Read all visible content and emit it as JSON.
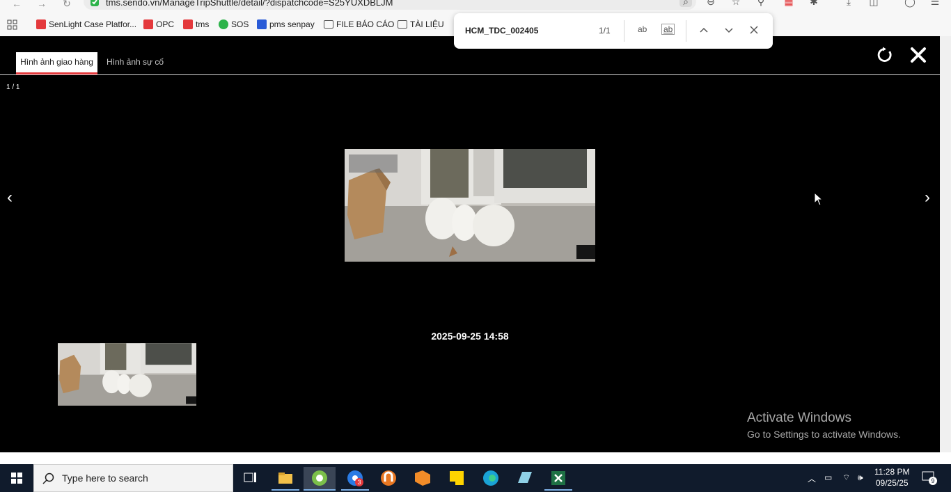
{
  "browser": {
    "url": "tms.sendo.vn/ManageTripShuttle/detail/?dispatchcode=S25YUXDBLJM",
    "bookmarks": [
      {
        "label": "SenLight Case Platfor...",
        "icon": "sendo-icon",
        "color": "#e4393c"
      },
      {
        "label": "OPC",
        "icon": "sendo-icon",
        "color": "#e4393c"
      },
      {
        "label": "tms",
        "icon": "sendo-icon",
        "color": "#e4393c"
      },
      {
        "label": "SOS",
        "icon": "sos-icon",
        "color": "#2db34a"
      },
      {
        "label": "pms senpay",
        "icon": "senpay-icon",
        "color": "#2a5bd7"
      },
      {
        "label": "FILE BÁO CÁO",
        "icon": "folder-icon",
        "color": "#555555"
      },
      {
        "label": "TÀI LIỆU",
        "icon": "folder-icon",
        "color": "#555555"
      }
    ]
  },
  "find_bar": {
    "query": "HCM_TDC_002405",
    "count": "1/1",
    "match_case": "ab",
    "whole_word": "ab"
  },
  "viewer": {
    "tabs": [
      {
        "label": "Hình ảnh giao hàng",
        "active": true
      },
      {
        "label": "Hình ảnh sự cố",
        "active": false
      }
    ],
    "counter": "1 / 1",
    "prev_symbol": "‹",
    "next_symbol": "›",
    "date": "2025-09-25 14:58"
  },
  "watermark": {
    "line1": "Activate Windows",
    "line2": "Go to Settings to activate Windows."
  },
  "taskbar": {
    "search_placeholder": "Type here to search",
    "chrome_badge": "3",
    "time": "11:28 PM",
    "date": "09/25/25",
    "notification_count": "9"
  },
  "colors": {
    "accent": "#e4393c",
    "viewer_bg": "#000000",
    "taskbar_bg": "#101b2c"
  }
}
